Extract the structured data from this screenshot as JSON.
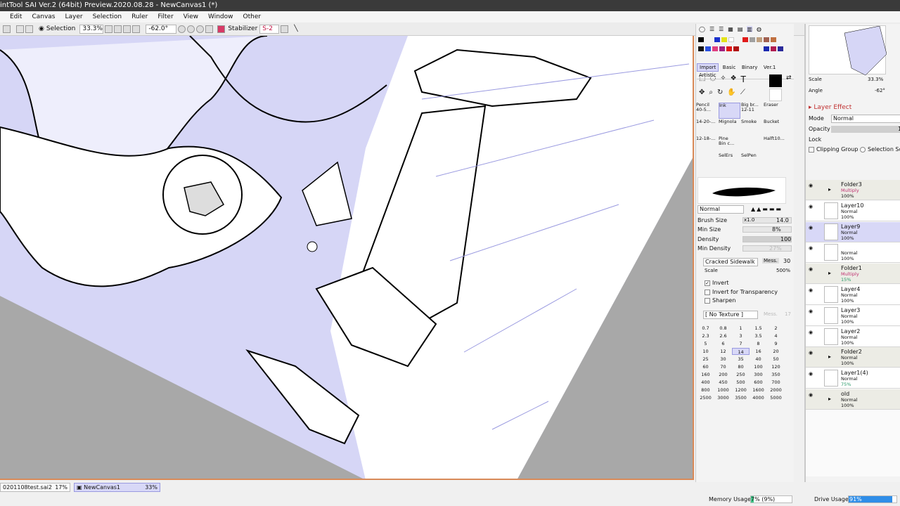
{
  "app": {
    "title": "intTool SAI Ver.2 (64bit) Preview.2020.08.28 - NewCanvas1 (*)"
  },
  "menu": [
    "Edit",
    "Canvas",
    "Layer",
    "Selection",
    "Ruler",
    "Filter",
    "View",
    "Window",
    "Other"
  ],
  "toolbar": {
    "selection_label": "Selection",
    "zoom": "33.3%",
    "angle": "-62.0°",
    "stabilizer_label": "Stabilizer",
    "stabilizer_value": "S-2"
  },
  "navigator": {
    "scale_label": "Scale",
    "scale_value": "33.3%",
    "angle_label": "Angle",
    "angle_value": "-62°"
  },
  "colors": {
    "accent": "#d98a58",
    "selected_tab": "#d8d8f7",
    "canvas_fill": "#d6d6f6",
    "memory_bar": "#40c88a",
    "drive_bar": "#2f8ee8"
  },
  "tools": {
    "tabs": [
      "Import",
      "Basic",
      "Binary",
      "Ver.1",
      "Artistic"
    ],
    "brushes": [
      {
        "name": "Pencil",
        "sub": "40-5..."
      },
      {
        "name": "Ink",
        "sub": ""
      },
      {
        "name": "Big br...",
        "sub": "12-11"
      },
      {
        "name": "Eraser",
        "sub": ""
      },
      {
        "name": "Mignola",
        "sub": "14-20-..."
      },
      {
        "name": "Smoke",
        "sub": ""
      },
      {
        "name": "Bucket",
        "sub": ""
      },
      {
        "name": "",
        "sub": ""
      },
      {
        "name": "Pine",
        "sub": "12-18-..."
      },
      {
        "name": "",
        "sub": ""
      },
      {
        "name": "",
        "sub": ""
      },
      {
        "name": "Halft10...",
        "sub": ""
      },
      {
        "name": "SelErs",
        "sub": "Bin c..."
      },
      {
        "name": "SelPen",
        "sub": ""
      }
    ],
    "blend_mode": "Normal",
    "brush_size_label": "Brush Size",
    "brush_size_mult": "x1.0",
    "brush_size_value": "14.0",
    "min_size_label": "Min Size",
    "min_size_value": "8%",
    "density_label": "Density",
    "density_value": "100",
    "min_density_label": "Min Density",
    "min_density_value": "27%",
    "texture_name": "Cracked Sidewalk",
    "texture_mess": "Mess.",
    "texture_mess_value": "30",
    "scale_label": "Scale",
    "scale_value": "500%",
    "invert_label": "Invert",
    "invert_transparency_label": "Invert for Transparency",
    "sharpen_label": "Sharpen",
    "no_texture": "[ No Texture ]",
    "no_texture_val": "Mess.",
    "no_texture_num": "17",
    "size_grid": [
      "0.7",
      "0.8",
      "1",
      "1.5",
      "2",
      "2.3",
      "2.6",
      "3",
      "3.5",
      "4",
      "5",
      "6",
      "7",
      "8",
      "9",
      "10",
      "12",
      "14",
      "16",
      "20",
      "25",
      "30",
      "35",
      "40",
      "50",
      "60",
      "70",
      "80",
      "100",
      "120",
      "160",
      "200",
      "250",
      "300",
      "350",
      "400",
      "450",
      "500",
      "600",
      "700",
      "800",
      "1000",
      "1200",
      "1600",
      "2000",
      "2500",
      "3000",
      "3500",
      "4000",
      "5000"
    ],
    "selected_size": "14"
  },
  "layer_panel": {
    "layer_effect_label": "Layer Effect",
    "mode_label": "Mode",
    "mode_value": "Normal",
    "opacity_label": "Opacity",
    "opacity_value": "1",
    "lock_label": "Lock",
    "clipping_group_label": "Clipping Group",
    "selection_source_label": "Selection So",
    "layers": [
      {
        "name": "Folder3",
        "mode": "Multiply",
        "opacity": "100%",
        "type": "folder"
      },
      {
        "name": "Layer10",
        "mode": "Normal",
        "opacity": "100%",
        "type": "layer"
      },
      {
        "name": "Layer9",
        "mode": "Normal",
        "opacity": "100%",
        "type": "selected"
      },
      {
        "name": "",
        "mode": "Normal",
        "opacity": "100%",
        "type": "layer"
      },
      {
        "name": "Folder1",
        "mode": "Multiply",
        "opacity": "15%",
        "type": "folder"
      },
      {
        "name": "Layer4",
        "mode": "Normal",
        "opacity": "100%",
        "type": "layer"
      },
      {
        "name": "Layer3",
        "mode": "Normal",
        "opacity": "100%",
        "type": "layer"
      },
      {
        "name": "Layer2",
        "mode": "Normal",
        "opacity": "100%",
        "type": "layer"
      },
      {
        "name": "Folder2",
        "mode": "Normal",
        "opacity": "100%",
        "type": "folder"
      },
      {
        "name": "Layer1(4)",
        "mode": "Normal",
        "opacity": "75%",
        "type": "layer"
      },
      {
        "name": "old",
        "mode": "Normal",
        "opacity": "100%",
        "type": "folder"
      }
    ]
  },
  "status": {
    "doc1_name": "0201108test.sai2",
    "doc1_zoom": "17%",
    "doc2_name": "NewCanvas1",
    "doc2_zoom": "33%",
    "memory_label": "Memory Usage",
    "memory_value": "7% (9%)",
    "memory_fill": 0.07,
    "drive_label": "Drive Usage",
    "drive_value": "91%",
    "drive_fill": 0.91
  }
}
